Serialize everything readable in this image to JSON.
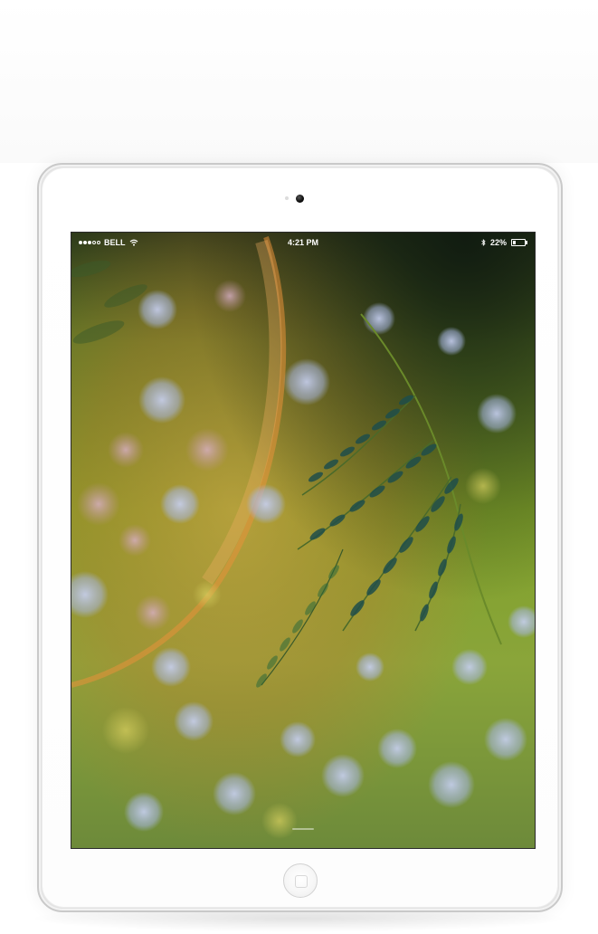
{
  "status_bar": {
    "signal_strength": 3,
    "signal_max": 5,
    "carrier": "BELL",
    "wifi_icon": "wifi-icon",
    "time": "4:21 PM",
    "bluetooth_icon": "bluetooth-icon",
    "battery_percent": "22%",
    "battery_level": 0.22
  },
  "device": {
    "model_style": "white-tablet",
    "frame_color": "#ffffff",
    "bezel_border": "#c9c9c9"
  },
  "wallpaper": {
    "subject": "fern-leaves-bokeh",
    "colors": {
      "green": "#7fa02a",
      "dark_green": "#2f4a1c",
      "orange": "#d9822b",
      "blue_bokeh": "#a9b7e6",
      "teal_leaf": "#1f4d4a"
    }
  },
  "home_button": {
    "icon": "home-button-icon"
  }
}
